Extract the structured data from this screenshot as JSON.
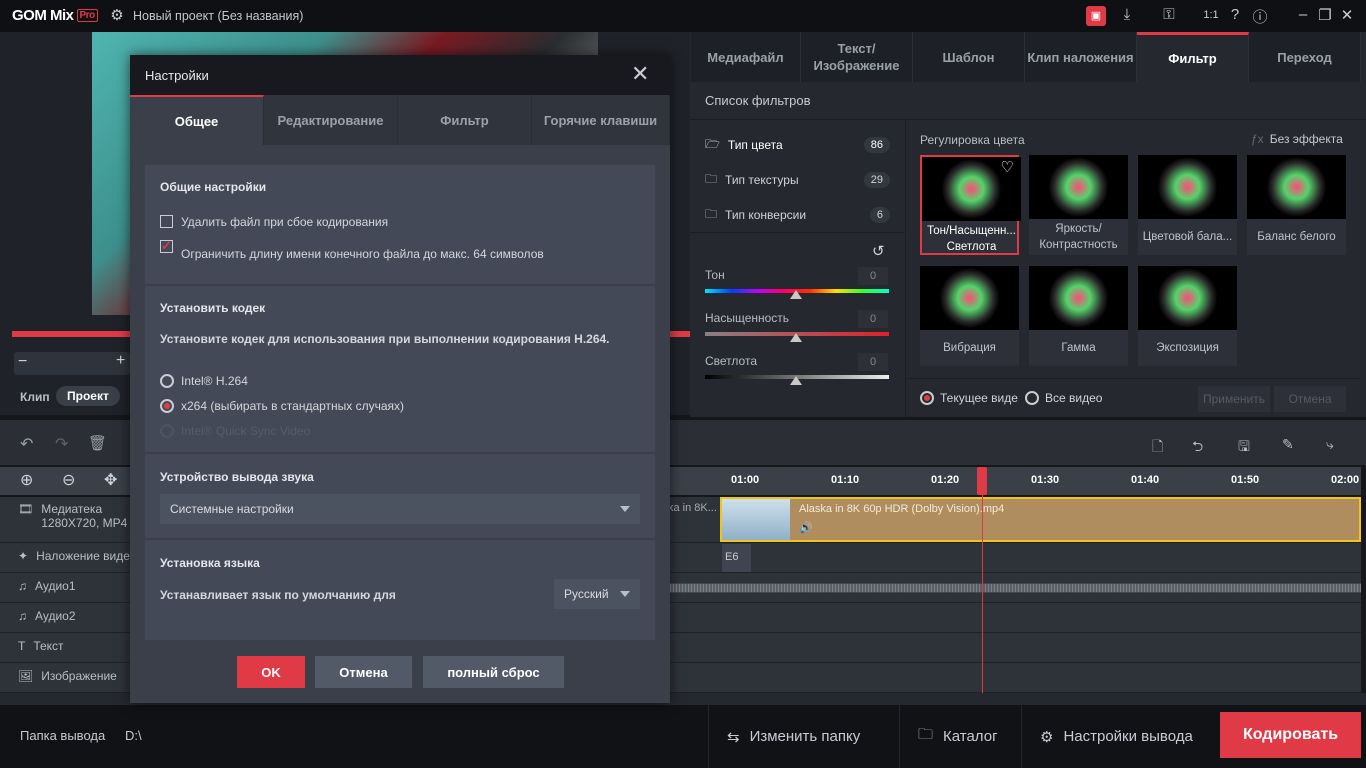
{
  "app": {
    "logo": "GOM Mix",
    "logo_badge": "Pro",
    "project_title": "Новый проект (Без названия)"
  },
  "colors": {
    "accent": "#e03a47",
    "clip": "#b08d5e",
    "clip_border": "#f0c419"
  },
  "preview": {
    "clip_label": "Клип",
    "project_label": "Проект"
  },
  "right_tabs": [
    "Медиафайл",
    "Текст/ Изображение",
    "Шаблон",
    "Клип наложения",
    "Фильтр",
    "Переход"
  ],
  "filters": {
    "list_title": "Список фильтров",
    "categories": [
      {
        "label": "Тип цвета",
        "count": "86"
      },
      {
        "label": "Тип текстуры",
        "count": "29"
      },
      {
        "label": "Тип конверсии",
        "count": "6"
      }
    ],
    "sliders": [
      {
        "label": "Тон",
        "value": "0"
      },
      {
        "label": "Насыщенность",
        "value": "0"
      },
      {
        "label": "Светлота",
        "value": "0"
      }
    ],
    "group_title": "Регулировка цвета",
    "no_effect": "Без эффекта",
    "tiles": [
      "Тон/Насыщенн... Светлота",
      "Яркость/ Контрастность",
      "Цветовой бала...",
      "Баланс белого",
      "Вибрация",
      "Гамма",
      "Экспозиция"
    ],
    "selected_tile": 0,
    "scope_current": "Текущее виде",
    "scope_all": "Все видео",
    "apply": "Применить",
    "cancel": "Отмена"
  },
  "timeline": {
    "ticks": [
      "01:00",
      "01:10",
      "01:20",
      "01:30",
      "01:40",
      "01:50",
      "02:00"
    ],
    "playhead": "01:23.7",
    "tracks": [
      {
        "label": "Медиатека",
        "sub": "1280X720, MP4"
      },
      {
        "label": "Наложение видео"
      },
      {
        "label": "Аудио1"
      },
      {
        "label": "Аудио2"
      },
      {
        "label": "Текст"
      },
      {
        "label": "Изображение"
      }
    ],
    "prev_clip": "ka in 8K...",
    "clip_name": "Alaska in 8K 60p HDR  (Dolby Vision).mp4",
    "overlay_clip": "E6"
  },
  "bottom": {
    "output_folder_label": "Папка вывода",
    "output_folder": "D:\\",
    "change_folder": "Изменить папку",
    "catalog": "Каталог",
    "output_settings": "Настройки вывода",
    "encode": "Кодировать"
  },
  "dialog": {
    "title": "Настройки",
    "tabs": [
      "Общее",
      "Редактирование",
      "Фильтр",
      "Горячие клавиши"
    ],
    "general_heading": "Общие настройки",
    "delete_on_fail": "Удалить файл при сбое кодирования",
    "delete_on_fail_checked": false,
    "limit_name": "Ограничить длину имени конечного файла до макс. 64 символов",
    "limit_name_checked": true,
    "codec_heading": "Установить кодек",
    "codec_desc": "Установите кодек для использования при выполнении кодирования H.264.",
    "codec_options": [
      "Intel® H.264",
      "x264 (выбирать в стандартных случаях)",
      "Intel® Quick Sync Video"
    ],
    "codec_selected": 1,
    "audio_heading": "Устройство вывода звука",
    "audio_device": "Системные настройки",
    "lang_heading": "Установка языка",
    "lang_desc": "Устанавливает язык по умолчанию для",
    "lang_value": "Русский",
    "ok": "OK",
    "cancel": "Отмена",
    "reset": "полный сброс"
  }
}
